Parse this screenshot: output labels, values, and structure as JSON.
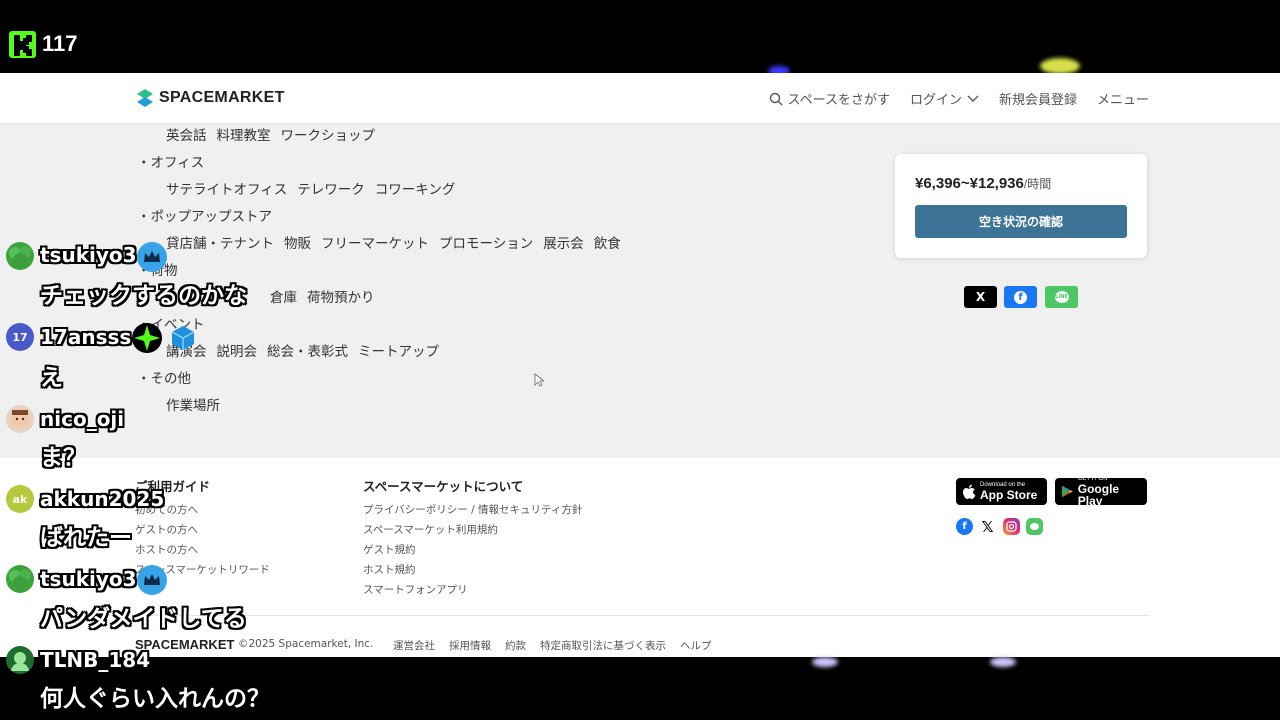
{
  "stream": {
    "viewer_count": "117"
  },
  "header": {
    "brand": "SPACEMARKET",
    "nav": {
      "search": "スペースをさがす",
      "login": "ログイン",
      "signup": "新規会員登録",
      "menu": "メニュー"
    }
  },
  "categories": [
    {
      "type": "sub",
      "items": [
        "英会話",
        "料理教室",
        "ワークショップ"
      ]
    },
    {
      "type": "head",
      "label": "・オフィス"
    },
    {
      "type": "sub",
      "items": [
        "サテライトオフィス",
        "テレワーク",
        "コワーキング"
      ]
    },
    {
      "type": "head",
      "label": "・ポップアップストア"
    },
    {
      "type": "sub",
      "items": [
        "貸店舗・テナント",
        "物販",
        "フリーマーケット",
        "プロモーション",
        "展示会",
        "飲食"
      ]
    },
    {
      "type": "head",
      "label": "・荷物"
    },
    {
      "type": "sub",
      "items": [
        "倉庫",
        "荷物預かり"
      ]
    },
    {
      "type": "head",
      "label": "・イベント"
    },
    {
      "type": "sub",
      "items": [
        "講演会",
        "説明会",
        "総会・表彰式",
        "ミートアップ"
      ]
    },
    {
      "type": "head",
      "label": "・その他"
    },
    {
      "type": "sub",
      "items": [
        "作業場所"
      ]
    }
  ],
  "price_card": {
    "price": "¥6,396~¥12,936",
    "unit": "/時間",
    "button": "空き状況の確認"
  },
  "share": {
    "x": "X",
    "facebook": "f",
    "line": "LINE"
  },
  "footer": {
    "guide": {
      "title": "ご利用ガイド",
      "links": [
        "初めての方へ",
        "ゲストの方へ",
        "ホストの方へ",
        "スペースマーケットリワード"
      ]
    },
    "about": {
      "title": "スペースマーケットについて",
      "links": [
        "プライバシーポリシー / 情報セキュリティ方針",
        "スペースマーケット利用規約",
        "ゲスト規約",
        "ホスト規約",
        "スマートフォンアプリ"
      ]
    },
    "app_store": {
      "small": "Download on the",
      "big": "App Store"
    },
    "google_play": {
      "small": "GET IT ON",
      "big": "Google Play"
    },
    "brand": "SPACEMARKET",
    "copyright": "©2025 Spacemarket, Inc.",
    "bottom_links": [
      "運営会社",
      "採用情報",
      "約款",
      "特定商取引法に基づく表示",
      "ヘルプ"
    ]
  },
  "chat": [
    {
      "user": "tsukiyo3",
      "message": "チェックするのかな"
    },
    {
      "user": "17ansss",
      "avatar_text": "17",
      "message": "え"
    },
    {
      "user": "nico_oji",
      "message": "ま？"
    },
    {
      "user": "akkun2025",
      "avatar_text": "ak",
      "message": "ばれたー"
    },
    {
      "user": "tsukiyo3",
      "message": "パンダメイドしてる"
    },
    {
      "user": "TLNB_184",
      "message": "何人ぐらい入れんの？"
    }
  ],
  "colors": {
    "kick_green": "#53fc18",
    "button_blue": "#3e7398",
    "line_green": "#4cc764",
    "facebook_blue": "#1877f2"
  }
}
